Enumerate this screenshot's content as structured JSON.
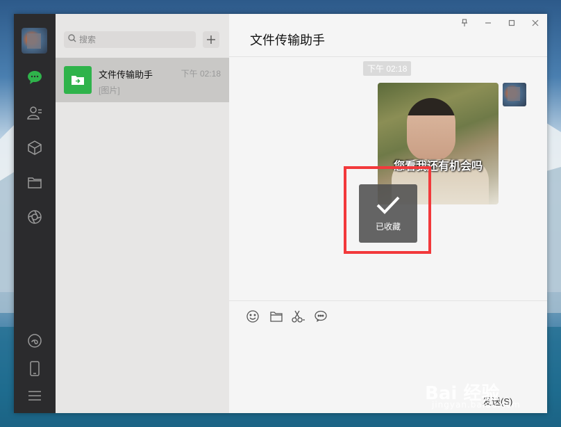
{
  "search": {
    "placeholder": "搜索"
  },
  "chat_list": [
    {
      "name": "文件传输助手",
      "time": "下午 02:18",
      "preview": "[图片]"
    }
  ],
  "conversation": {
    "title": "文件传输助手",
    "timestamp": "下午 02:18",
    "image_caption": "您看我还有机会吗"
  },
  "toast": {
    "label": "已收藏"
  },
  "input": {
    "send_label": "发送(S)"
  },
  "watermark": {
    "brand": "Bai 经验",
    "url": "jingyan.baidu.com"
  },
  "colors": {
    "accent": "#2fb34b",
    "highlight": "#f2393b",
    "sidebar": "#2b2b2d"
  }
}
